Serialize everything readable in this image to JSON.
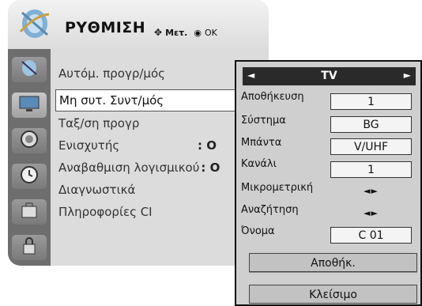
{
  "header": {
    "title": "ΡΥΘΜΙΣΗ",
    "move_label": "Μετ.",
    "ok_label": "OK"
  },
  "sidebar": {
    "icons": [
      "satellite-dish-icon",
      "tv-screen-icon",
      "speaker-icon",
      "clock-icon",
      "briefcase-icon",
      "lock-icon"
    ]
  },
  "menu": {
    "items": [
      {
        "label": "Αυτόμ. προγρ/μός",
        "value": ""
      },
      {
        "label": "Μη συτ. Συντ/μός",
        "value": ""
      },
      {
        "label": "Ταξ/ση προγρ",
        "value": ""
      },
      {
        "label": "Ενισχυτής",
        "value": ": Ο"
      },
      {
        "label": "Αναβαθμιση λογισμικού",
        "value": ": Ο"
      },
      {
        "label": "Διαγνωστικά",
        "value": ""
      },
      {
        "label": "Πληροφορίες CI",
        "value": ""
      }
    ]
  },
  "popup": {
    "title": "TV",
    "left_arrow": "◄",
    "right_arrow": "►",
    "rows": [
      {
        "label": "Αποθήκευση",
        "value": "1"
      },
      {
        "label": "Σύστημα",
        "value": "BG"
      },
      {
        "label": "Μπάντα",
        "value": "V/UHF"
      },
      {
        "label": "Κανάλι",
        "value": "1"
      },
      {
        "label": "Μικρομετρική",
        "value": "◄►"
      },
      {
        "label": "Αναζήτηση",
        "value": "◄►"
      },
      {
        "label": "Όνομα",
        "value": "C 01"
      }
    ],
    "store_button": "Αποθήκ.",
    "close_button": "Κλείσιμο"
  }
}
